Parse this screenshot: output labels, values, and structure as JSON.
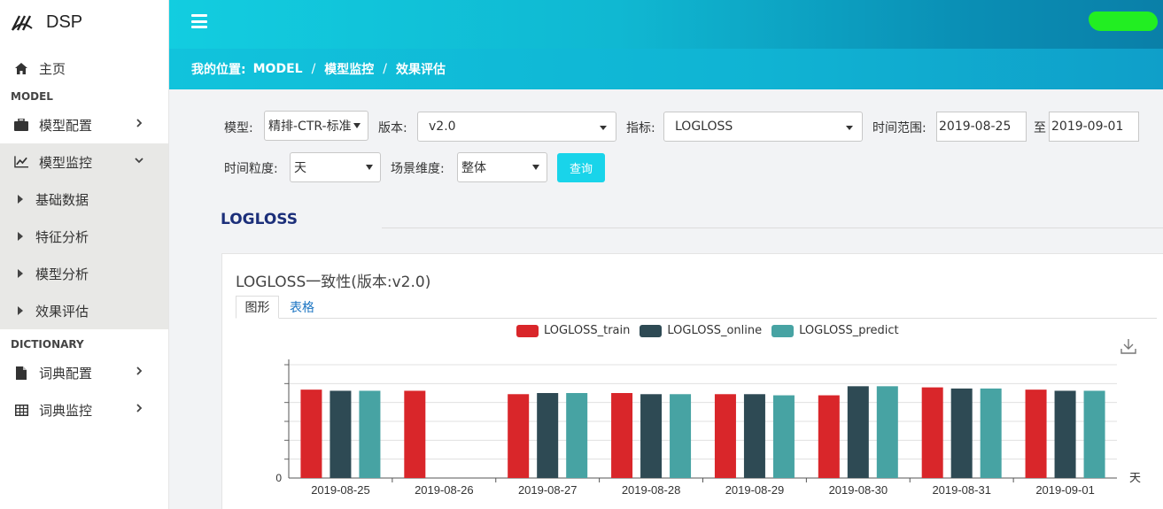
{
  "app": {
    "title": "DSP"
  },
  "sidebar": {
    "home": "主页",
    "section_model": "MODEL",
    "model_config": "模型配置",
    "model_monitor": "模型监控",
    "sub_items": [
      "基础数据",
      "特征分析",
      "模型分析",
      "效果评估"
    ],
    "section_dictionary": "DICTIONARY",
    "dict_config": "词典配置",
    "dict_monitor": "词典监控"
  },
  "breadcrumb": {
    "prefix": "我的位置:",
    "items": [
      "MODEL",
      "模型监控",
      "效果评估"
    ],
    "separator": "/"
  },
  "filters": {
    "model_label": "模型:",
    "model_value": "精排-CTR-标准",
    "version_label": "版本:",
    "version_value": "v2.0",
    "metric_label": "指标:",
    "metric_value": "LOGLOSS",
    "time_range_label": "时间范围:",
    "date_start": "2019-08-25",
    "to_label": "至",
    "date_end": "2019-09-01",
    "granularity_label": "时间粒度:",
    "granularity_value": "天",
    "scene_label": "场景维度:",
    "scene_value": "整体",
    "query_button": "查询"
  },
  "section": {
    "title": "LOGLOSS"
  },
  "panel": {
    "title": "LOGLOSS一致性(版本:v2.0)",
    "tab_graph": "图形",
    "tab_table": "表格"
  },
  "icons": {
    "home": "home-icon",
    "model_config": "briefcase-icon",
    "model_monitor": "line-chart-icon",
    "dict_config": "file-icon",
    "dict_monitor": "table-icon",
    "download": "download-icon"
  },
  "colors": {
    "train": "#d9262a",
    "online": "#2e4a54",
    "predict": "#47a3a3",
    "accent": "#19d4ea"
  },
  "chart_data": {
    "type": "bar",
    "categories": [
      "2019-08-25",
      "2019-08-26",
      "2019-08-27",
      "2019-08-28",
      "2019-08-29",
      "2019-08-30",
      "2019-08-31",
      "2019-09-01"
    ],
    "x_unit_label": "天",
    "y_zero_label": "0",
    "ylim": [
      0,
      1
    ],
    "grid": true,
    "legend_position": "top-center",
    "series": [
      {
        "name": "LOGLOSS_train",
        "color": "#d9262a",
        "values": [
          0.78,
          0.77,
          0.74,
          0.75,
          0.74,
          0.73,
          0.8,
          0.78
        ]
      },
      {
        "name": "LOGLOSS_online",
        "color": "#2e4a54",
        "values": [
          0.77,
          null,
          0.75,
          0.74,
          0.74,
          0.81,
          0.79,
          0.77
        ]
      },
      {
        "name": "LOGLOSS_predict",
        "color": "#47a3a3",
        "values": [
          0.77,
          null,
          0.75,
          0.74,
          0.73,
          0.81,
          0.79,
          0.77
        ]
      }
    ]
  }
}
